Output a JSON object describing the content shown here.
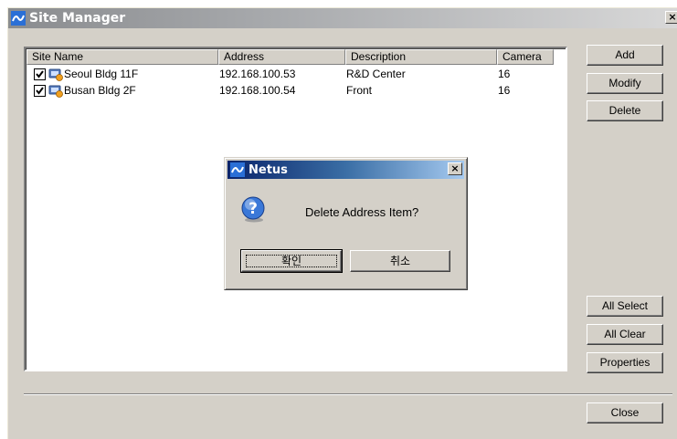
{
  "window": {
    "title": "Site Manager",
    "close_glyph": "×"
  },
  "columns": [
    "Site Name",
    "Address",
    "Description",
    "Camera"
  ],
  "rows": [
    {
      "checked": true,
      "name": "Seoul Bldg 11F",
      "address": "192.168.100.53",
      "description": "R&D Center",
      "camera": "16"
    },
    {
      "checked": true,
      "name": "Busan Bldg 2F",
      "address": "192.168.100.54",
      "description": "Front",
      "camera": "16"
    }
  ],
  "buttons": {
    "add": "Add",
    "modify": "Modify",
    "delete": "Delete",
    "all_select": "All Select",
    "all_clear": "All Clear",
    "properties": "Properties",
    "close": "Close"
  },
  "dialog": {
    "title": "Netus",
    "close_glyph": "×",
    "message": "Delete Address Item?",
    "ok_label": "확인",
    "cancel_label": "취소"
  },
  "colors": {
    "window_bg": "#d4d0c8",
    "dialog_title_start": "#0a246a",
    "dialog_title_end": "#a6caf0"
  }
}
